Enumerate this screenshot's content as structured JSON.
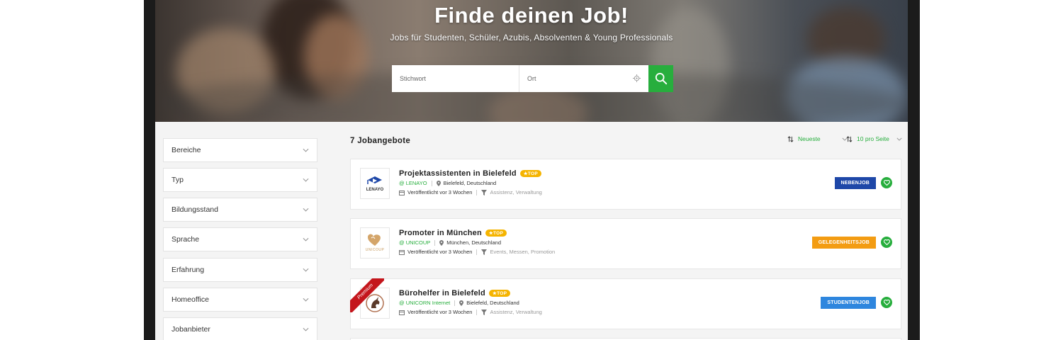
{
  "hero": {
    "title": "Finde deinen Job!",
    "subtitle": "Jobs für Studenten, Schüler, Azubis, Absolventen & Young Professionals",
    "keyword_placeholder": "Stichwort",
    "location_placeholder": "Ort"
  },
  "filters": [
    "Bereiche",
    "Typ",
    "Bildungsstand",
    "Sprache",
    "Erfahrung",
    "Homeoffice",
    "Jobanbieter"
  ],
  "results": {
    "count_label": "7 Jobangebote",
    "sort_label": "Neueste",
    "per_page_label": "10 pro Seite"
  },
  "jobs": [
    {
      "title": "Projektassistenten in Bielefeld",
      "top_label": "★TOP",
      "company": "@ LENAYO",
      "location": "Bielefeld, Deutschland",
      "published": "Veröffentlicht vor 3 Wochen",
      "categories": "Assistenz, Verwaltung",
      "type_label": "NEBENJOB",
      "type_color": "#1e47a8",
      "logo_text": "LENAYO"
    },
    {
      "title": "Promoter in München",
      "top_label": "★TOP",
      "company": "@ UNICOUP",
      "location": "München, Deutschland",
      "published": "Veröffentlicht vor 3 Wochen",
      "categories": "Events, Messen, Promotion",
      "type_label": "GELEGENHEITSJOB",
      "type_color": "#f39c12",
      "logo_text": "UNICOUP"
    },
    {
      "title": "Bürohelfer in Bielefeld",
      "top_label": "★TOP",
      "company": "@ UNICORN Internet",
      "location": "Bielefeld, Deutschland",
      "published": "Veröffentlicht vor 3 Wochen",
      "categories": "Assistenz, Verwaltung",
      "type_label": "STUDENTENJOB",
      "type_color": "#2e86de",
      "ribbon_label": "Premium"
    }
  ],
  "colors": {
    "accent": "#27ae3d",
    "top_badge": "#f5b400",
    "premium": "#c4161c"
  }
}
